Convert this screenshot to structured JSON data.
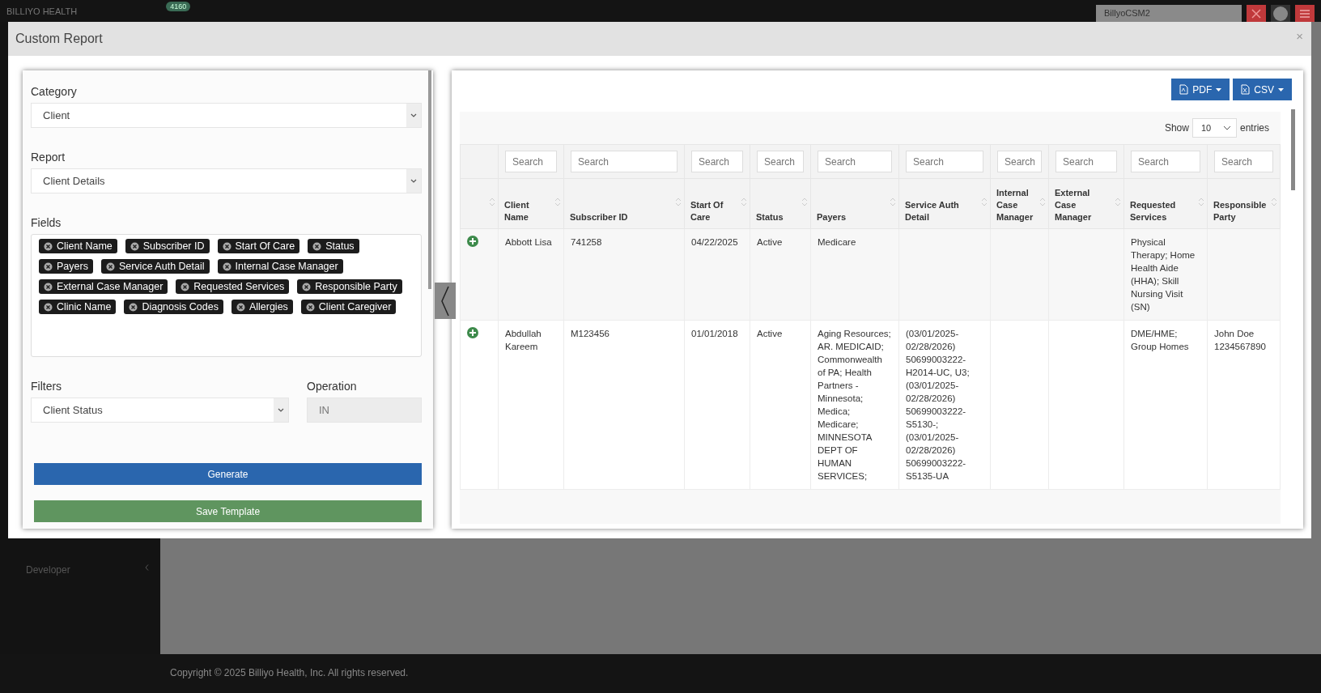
{
  "topbar": {
    "brand": "BILLIYO HEALTH",
    "badge": "4160",
    "user": "BillyoCSM2"
  },
  "sidebar": {
    "items": [
      {
        "label": "Developer"
      }
    ]
  },
  "footer": "Copyright © 2025 Billiyo Health, Inc. All rights reserved.",
  "modal": {
    "title": "Custom Report",
    "close": "×",
    "form": {
      "category": {
        "label": "Category",
        "value": "Client"
      },
      "report": {
        "label": "Report",
        "value": "Client Details"
      },
      "fields": {
        "label": "Fields",
        "chips": [
          "Client Name",
          "Subscriber ID",
          "Start Of Care",
          "Status",
          "Payers",
          "Service Auth Detail",
          "Internal Case Manager",
          "External Case Manager",
          "Requested Services",
          "Responsible Party",
          "Clinic Name",
          "Diagnosis Codes",
          "Allergies",
          "Client Caregiver"
        ]
      },
      "filters": {
        "label": "Filters",
        "value": "Client Status"
      },
      "operation": {
        "label": "Operation",
        "value": "IN",
        "disabled": true
      },
      "buttons": [
        {
          "label": "Generate",
          "kind": "primary"
        },
        {
          "label": "Save Template",
          "kind": "success"
        }
      ]
    },
    "report": {
      "exports": [
        {
          "label": "PDF",
          "kind": "pdf"
        },
        {
          "label": "CSV",
          "kind": "csv"
        }
      ],
      "length": {
        "show": "Show",
        "value": "10",
        "entries": "entries"
      },
      "table": {
        "columns": [
          {},
          {
            "label": "Client Name",
            "placeholder": "Search"
          },
          {
            "label": "Subscriber ID",
            "placeholder": "Search"
          },
          {
            "label": "Start Of Care",
            "placeholder": "Search"
          },
          {
            "label": "Status",
            "placeholder": "Search"
          },
          {
            "label": "Payers",
            "placeholder": "Search"
          },
          {
            "label": "Service Auth Detail",
            "placeholder": "Search"
          },
          {
            "label": "Internal Case Manager",
            "placeholder": "Search"
          },
          {
            "label": "External Case Manager",
            "placeholder": "Search"
          },
          {
            "label": "Requested Services",
            "placeholder": "Search"
          },
          {
            "label": "Responsible Party",
            "placeholder": "Search"
          }
        ],
        "rows": [
          {
            "cells": [
              "",
              "Abbott Lisa",
              "741258",
              "04/22/2025",
              "Active",
              "Medicare",
              "",
              "",
              "",
              "Physical Therapy; Home Health Aide (HHA); Skill Nursing Visit (SN)",
              ""
            ]
          },
          {
            "cells": [
              "",
              "Abdullah Kareem",
              "M123456",
              "01/01/2018",
              "Active",
              "Aging Resources; AR. MEDICAID; Commonwealth of PA; Health Partners - Minnesota; Medica; Medicare; MINNESOTA DEPT OF HUMAN SERVICES;",
              "(03/01/2025-02/28/2026) 50699003222-H2014-UC, U3; (03/01/2025-02/28/2026) 50699003222-S5130-; (03/01/2025-02/28/2026) 50699003222-S5135-UA",
              "",
              "",
              "DME/HME; Group Homes",
              "John Doe 1234567890"
            ]
          }
        ]
      }
    }
  }
}
